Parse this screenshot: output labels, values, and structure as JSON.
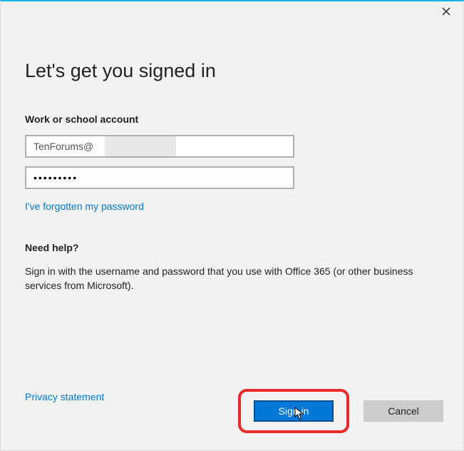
{
  "header": {
    "title": "Let's get you signed in"
  },
  "form": {
    "account_label": "Work or school account",
    "email_value": "TenForums@",
    "password_value": "•••••••••",
    "forgot_link": "I've forgotten my password"
  },
  "help": {
    "heading": "Need help?",
    "text": "Sign in with the username and password that you use with Office 365 (or other business services from Microsoft)."
  },
  "links": {
    "privacy": "Privacy statement"
  },
  "buttons": {
    "signin": "Sign in",
    "cancel": "Cancel"
  }
}
